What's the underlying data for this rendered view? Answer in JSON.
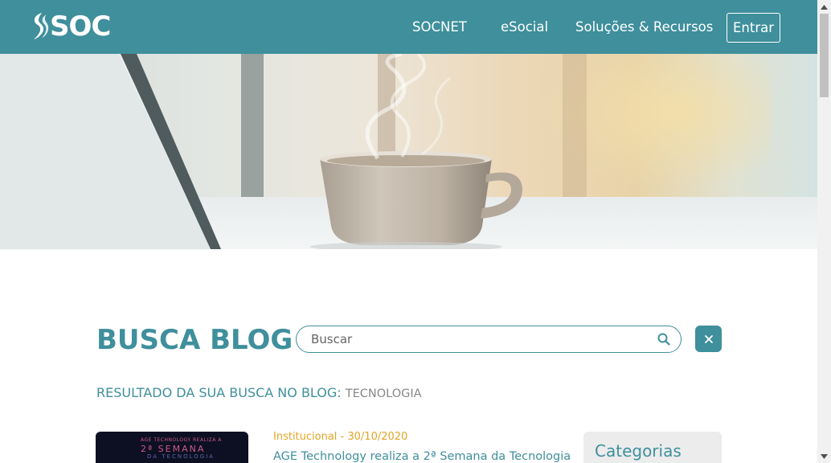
{
  "header": {
    "logo_text": "SOC",
    "nav": [
      {
        "label": "SOCNET"
      },
      {
        "label": "eSocial"
      },
      {
        "label": "Soluções & Recursos"
      }
    ],
    "login_label": "Entrar"
  },
  "hero": {
    "image": "coffee-cup-and-laptop-photo"
  },
  "search": {
    "title": "BUSCA BLOG",
    "placeholder": "Buscar",
    "value": "",
    "search_icon": "search-icon",
    "clear_icon": "close-icon"
  },
  "results": {
    "label": "RESULTADO DA SUA BUSCA NO BLOG:",
    "term": "TECNOLOGIA"
  },
  "posts": [
    {
      "thumbnail_text": [
        "AGE TECHNOLOGY REALIZA A",
        "2ª SEMANA",
        "DA TECNOLOGIA"
      ],
      "meta": "Institucional - 30/10/2020",
      "title": "AGE Technology realiza a 2ª Semana da Tecnologia"
    }
  ],
  "sidebar": {
    "categories_title": "Categorias"
  },
  "colors": {
    "brand": "#3f8f9c",
    "accent": "#e0a526",
    "sidebar_bg": "#ececec"
  }
}
